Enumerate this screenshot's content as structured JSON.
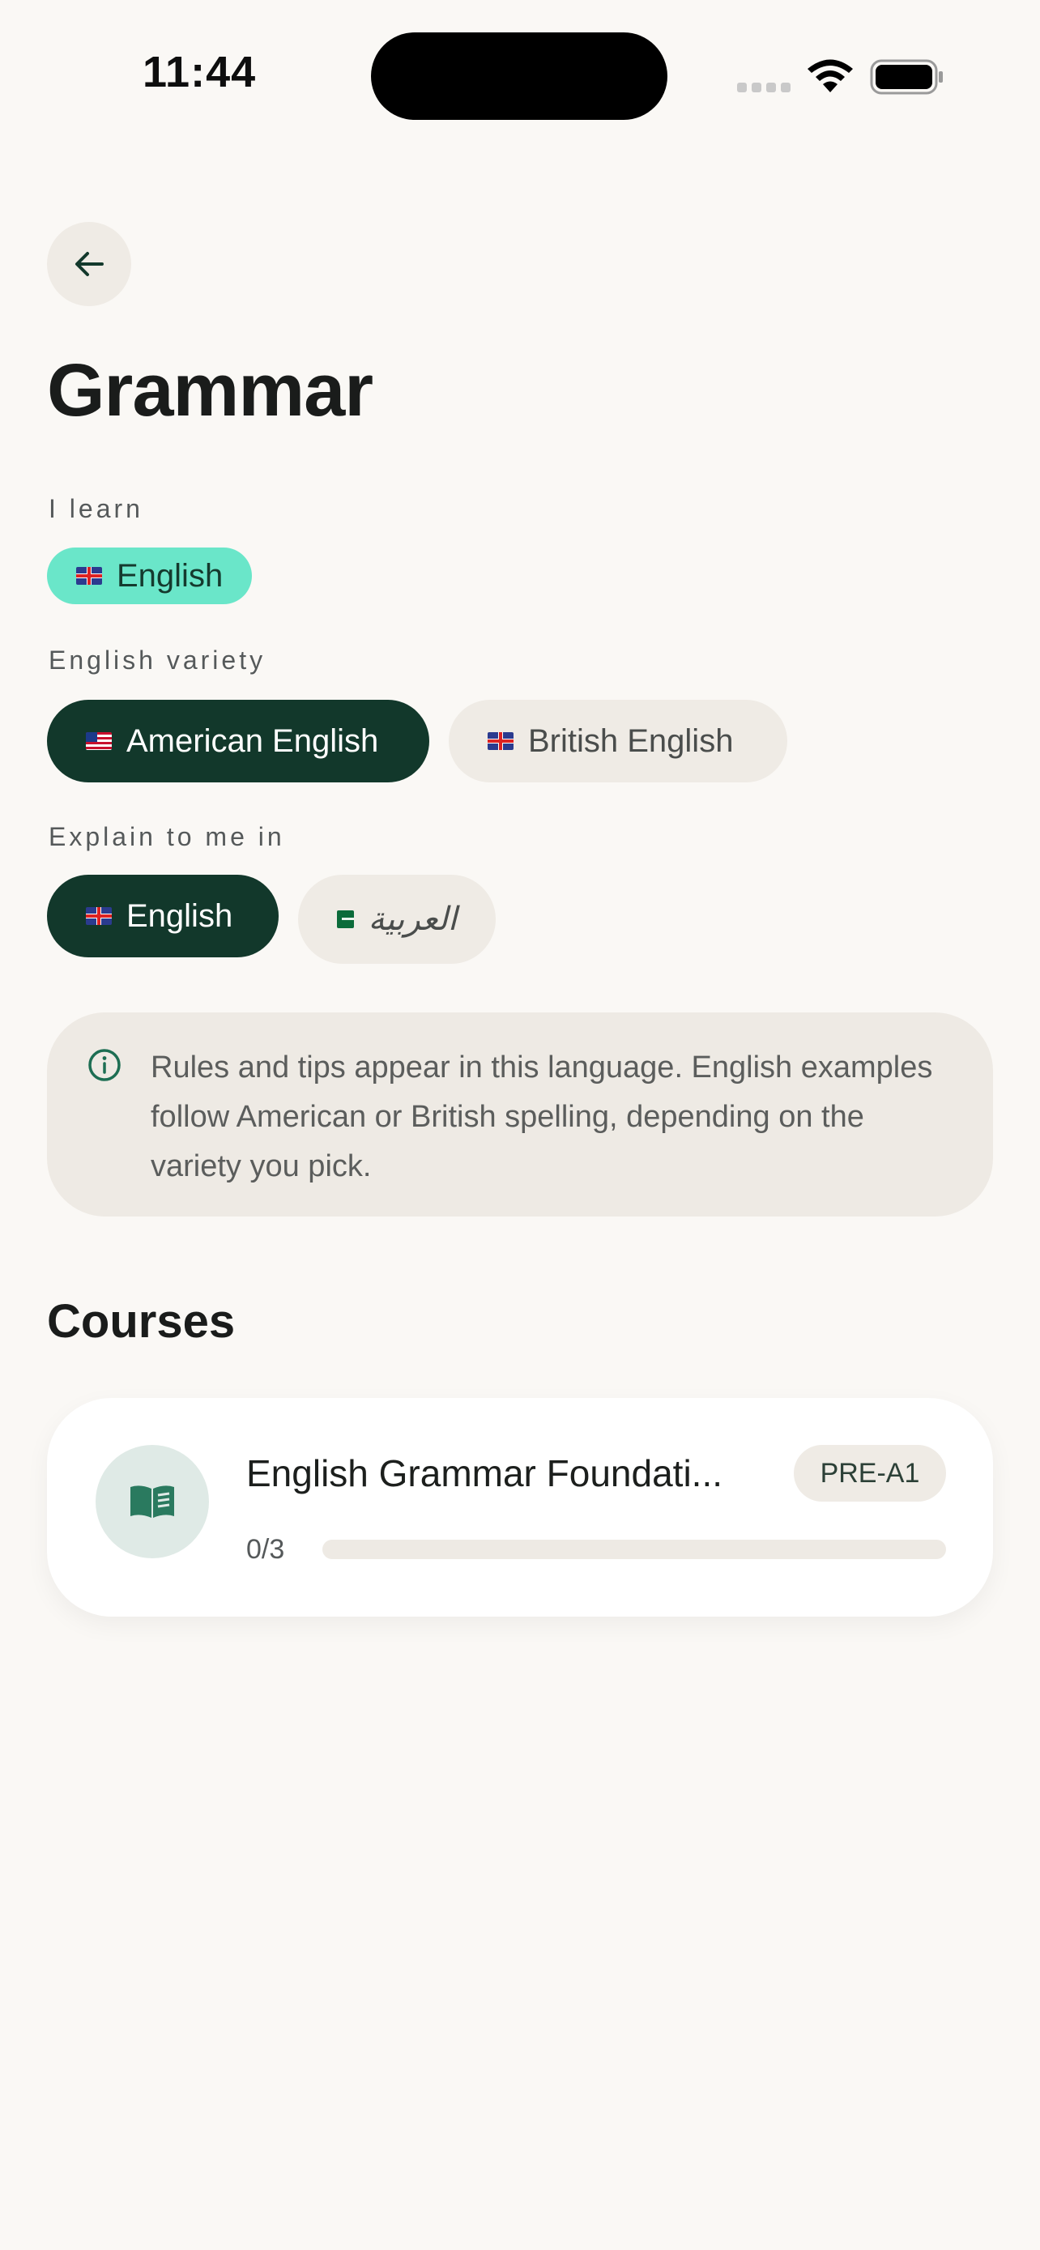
{
  "status_bar": {
    "time": "11:44"
  },
  "header": {
    "title": "Grammar"
  },
  "learn_section": {
    "label": "I learn",
    "selected": {
      "label": "English",
      "flag": "uk-flag"
    }
  },
  "variety_section": {
    "label": "English variety",
    "options": [
      {
        "label": "American English",
        "flag": "us-flag",
        "selected": true
      },
      {
        "label": "British English",
        "flag": "uk-flag",
        "selected": false
      }
    ]
  },
  "explain_section": {
    "label": "Explain to me in",
    "options": [
      {
        "label": "English",
        "flag": "uk-flag",
        "selected": true
      },
      {
        "label": "العربية",
        "flag": "sa-flag",
        "selected": false
      }
    ]
  },
  "info_box": {
    "icon": "info-icon",
    "text": "Rules and tips appear in this language. English examples follow American or British spelling, depending on the variety you pick."
  },
  "courses": {
    "title": "Courses",
    "items": [
      {
        "name": "English Grammar Foundati...",
        "level": "PRE-A1",
        "progress_text": "0/3",
        "progress": 0,
        "icon": "book-icon"
      }
    ]
  },
  "colors": {
    "accent_dark": "#12382b",
    "accent_mint": "#6ae6c9",
    "background": "#faf8f5",
    "chip_light": "#efebe5"
  }
}
